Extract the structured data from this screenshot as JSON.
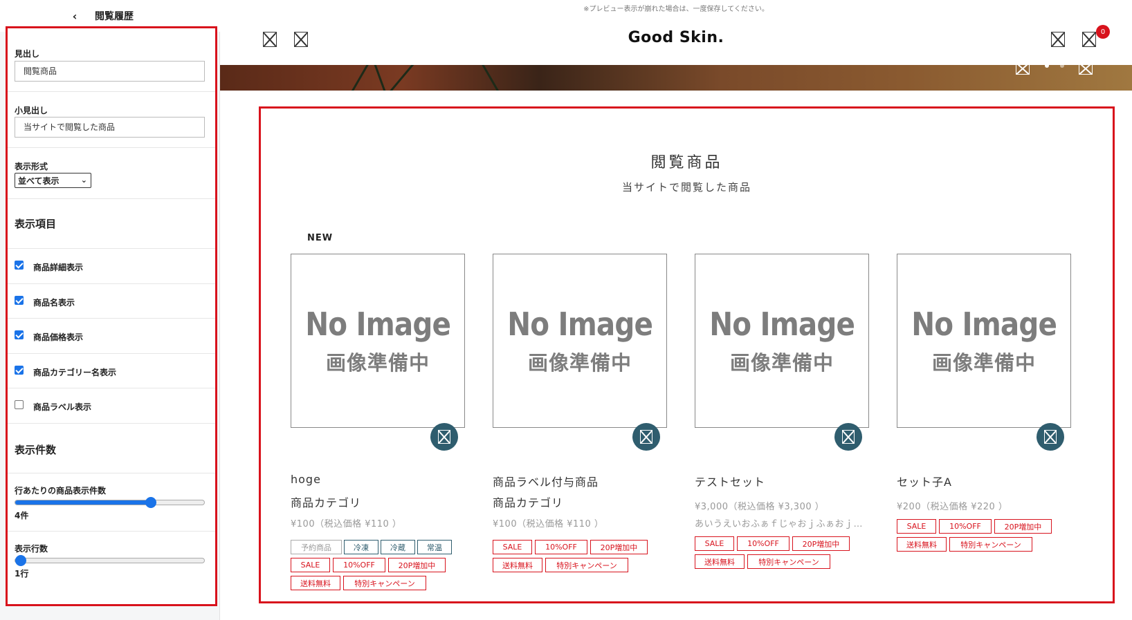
{
  "sidebar": {
    "title": "閲覧履歴",
    "heading_field": {
      "label": "見出し",
      "value": "閲覧商品"
    },
    "subheading_field": {
      "label": "小見出し",
      "value": "当サイトで閲覧した商品"
    },
    "display_format": {
      "label": "表示形式",
      "selected": "並べて表示"
    },
    "display_items_heading": "表示項目",
    "checkboxes": [
      {
        "label": "商品詳細表示",
        "checked": true
      },
      {
        "label": "商品名表示",
        "checked": true
      },
      {
        "label": "商品価格表示",
        "checked": true
      },
      {
        "label": "商品カテゴリー名表示",
        "checked": true
      },
      {
        "label": "商品ラベル表示",
        "checked": false
      }
    ],
    "count_heading": "表示件数",
    "per_row": {
      "label": "行あたりの商品表示件数",
      "value_text": "4件",
      "fraction": 0.73
    },
    "rows": {
      "label": "表示行数",
      "value_text": "1行",
      "fraction": 0.0
    }
  },
  "preview": {
    "notice": "※プレビュー表示が崩れた場合は、一度保存してください。",
    "brand": "Good Skin.",
    "cart_count": "0",
    "section_title": "閲覧商品",
    "section_subtitle": "当サイトで閲覧した商品",
    "no_image_text": "No Image",
    "no_image_sub": "画像準備中",
    "products": [
      {
        "new_label": "NEW",
        "name": "hoge",
        "category": "商品カテゴリ",
        "price": "¥100（税込価格 ¥110 ）",
        "tags_row1": [
          "予約商品",
          "冷凍",
          "冷蔵",
          "常温"
        ],
        "tags_row2": [
          "SALE",
          "10%OFF",
          "20P増加中"
        ],
        "tags_row3": [
          "送料無料",
          "特別キャンペーン"
        ]
      },
      {
        "name": "商品ラベル付与商品",
        "category": "商品カテゴリ",
        "price": "¥100（税込価格 ¥110 ）",
        "tags_row2": [
          "SALE",
          "10%OFF",
          "20P増加中"
        ],
        "tags_row3": [
          "送料無料",
          "特別キャンペーン"
        ]
      },
      {
        "name": "テストセット",
        "price": "¥3,000（税込価格 ¥3,300 ）",
        "description": "あいうえいおふぁｆじゃおｊふぁおｊ…",
        "tags_row2": [
          "SALE",
          "10%OFF",
          "20P増加中"
        ],
        "tags_row3": [
          "送料無料",
          "特別キャンペーン"
        ]
      },
      {
        "name": "セット子A",
        "price": "¥200（税込価格 ¥220 ）",
        "tags_row2": [
          "SALE",
          "10%OFF",
          "20P増加中"
        ],
        "tags_row3": [
          "送料無料",
          "特別キャンペーン"
        ]
      }
    ]
  }
}
